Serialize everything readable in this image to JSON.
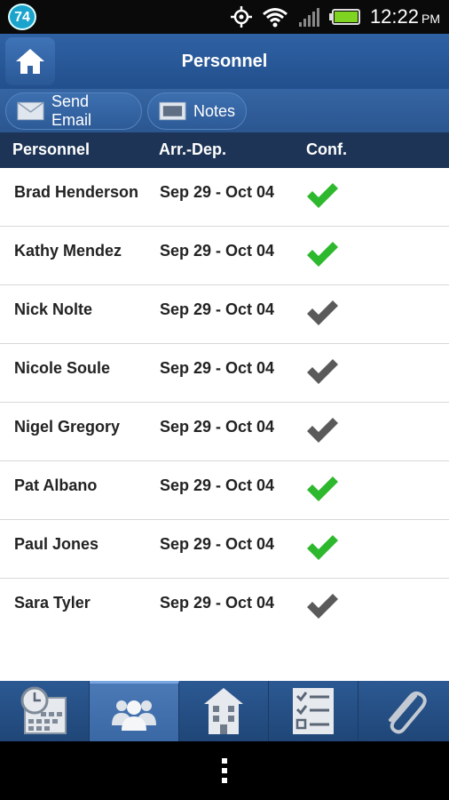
{
  "status_bar": {
    "badge": "74",
    "time": "12:22",
    "ampm": "PM",
    "icons": [
      "gps-icon",
      "wifi-icon",
      "signal-icon",
      "battery-icon"
    ]
  },
  "header": {
    "title": "Personnel",
    "home_icon": "home-icon"
  },
  "actions": {
    "send_email": "Send Email",
    "notes": "Notes"
  },
  "columns": {
    "personnel": "Personnel",
    "arr_dep": "Arr.-Dep.",
    "conf": "Conf."
  },
  "rows": [
    {
      "name": "Brad Henderson",
      "dates": "Sep 29 - Oct 04",
      "confirmed": true
    },
    {
      "name": "Kathy Mendez",
      "dates": "Sep 29 - Oct 04",
      "confirmed": true
    },
    {
      "name": "Nick Nolte",
      "dates": "Sep 29 - Oct 04",
      "confirmed": false
    },
    {
      "name": "Nicole Soule",
      "dates": "Sep 29 - Oct 04",
      "confirmed": false
    },
    {
      "name": "Nigel Gregory",
      "dates": "Sep 29 - Oct 04",
      "confirmed": false
    },
    {
      "name": "Pat Albano",
      "dates": "Sep 29 - Oct 04",
      "confirmed": true
    },
    {
      "name": "Paul Jones",
      "dates": "Sep 29 - Oct 04",
      "confirmed": true
    },
    {
      "name": "Sara Tyler",
      "dates": "Sep 29 - Oct 04",
      "confirmed": false
    }
  ],
  "colors": {
    "confirmed": "#2db82d",
    "unconfirmed": "#5a5a5a",
    "header": "#2a5896",
    "column_bar": "#1d3456"
  },
  "tabs": [
    {
      "icon": "calendar-clock-icon",
      "active": false
    },
    {
      "icon": "people-icon",
      "active": true
    },
    {
      "icon": "building-icon",
      "active": false
    },
    {
      "icon": "checklist-icon",
      "active": false
    },
    {
      "icon": "paperclip-icon",
      "active": false
    }
  ]
}
